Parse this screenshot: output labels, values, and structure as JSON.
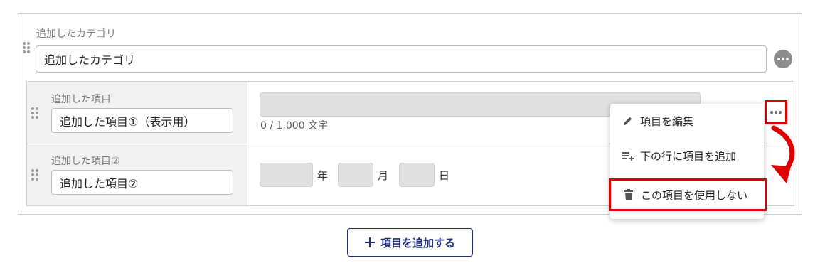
{
  "category": {
    "label": "追加したカテゴリ",
    "input_value": "追加したカテゴリ"
  },
  "items": [
    {
      "label": "追加した項目",
      "input_value": "追加した項目①（表示用）",
      "char_counter": "0 / 1,000 文字"
    },
    {
      "label": "追加した項目②",
      "input_value": "追加した項目②",
      "date_labels": {
        "year": "年",
        "month": "月",
        "day": "日"
      }
    }
  ],
  "context_menu": {
    "items": [
      {
        "label": "項目を編集",
        "icon": "pencil-icon"
      },
      {
        "label": "下の行に項目を追加",
        "icon": "add-row-below-icon"
      },
      {
        "label": "この項目を使用しない",
        "icon": "trash-icon"
      }
    ]
  },
  "add_item_button": {
    "label": "項目を追加する",
    "icon": "plus-icon"
  },
  "colors": {
    "highlight": "#e00000",
    "button_accent": "#1f2d7a",
    "more_button": "#8c8c8c"
  }
}
